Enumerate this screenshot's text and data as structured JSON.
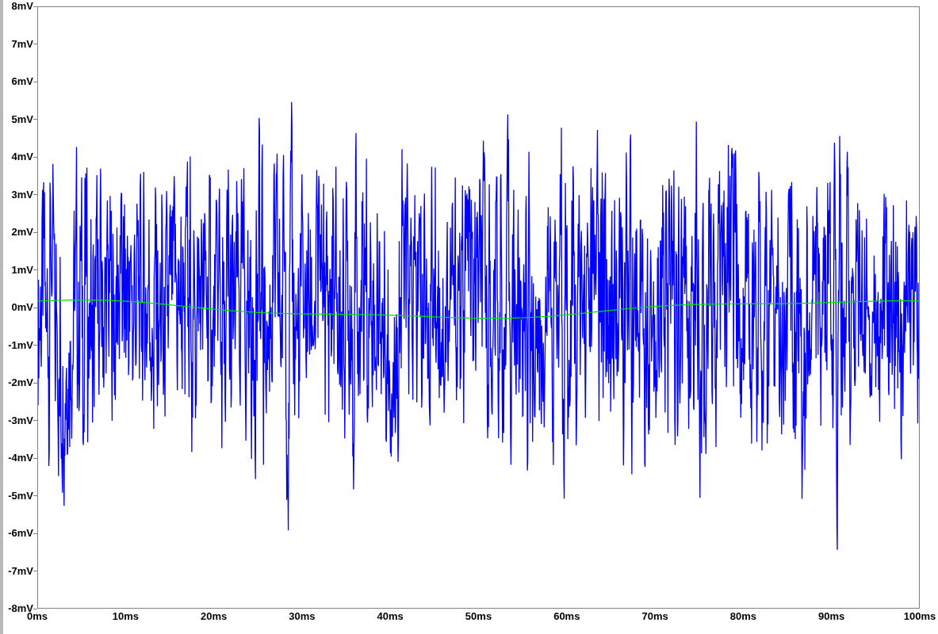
{
  "plot": {
    "yticks": [
      "8mV",
      "7mV",
      "6mV",
      "5mV",
      "4mV",
      "3mV",
      "2mV",
      "1mV",
      "0mV",
      "-1mV",
      "-2mV",
      "-3mV",
      "-4mV",
      "-5mV",
      "-6mV",
      "-7mV",
      "-8mV"
    ],
    "xticks": [
      "0ms",
      "10ms",
      "20ms",
      "30ms",
      "40ms",
      "50ms",
      "60ms",
      "70ms",
      "80ms",
      "90ms",
      "100ms"
    ],
    "traces": [
      {
        "kind": "noise",
        "color": "#0000ff"
      },
      {
        "kind": "smooth",
        "color": "#00e000"
      }
    ]
  }
}
